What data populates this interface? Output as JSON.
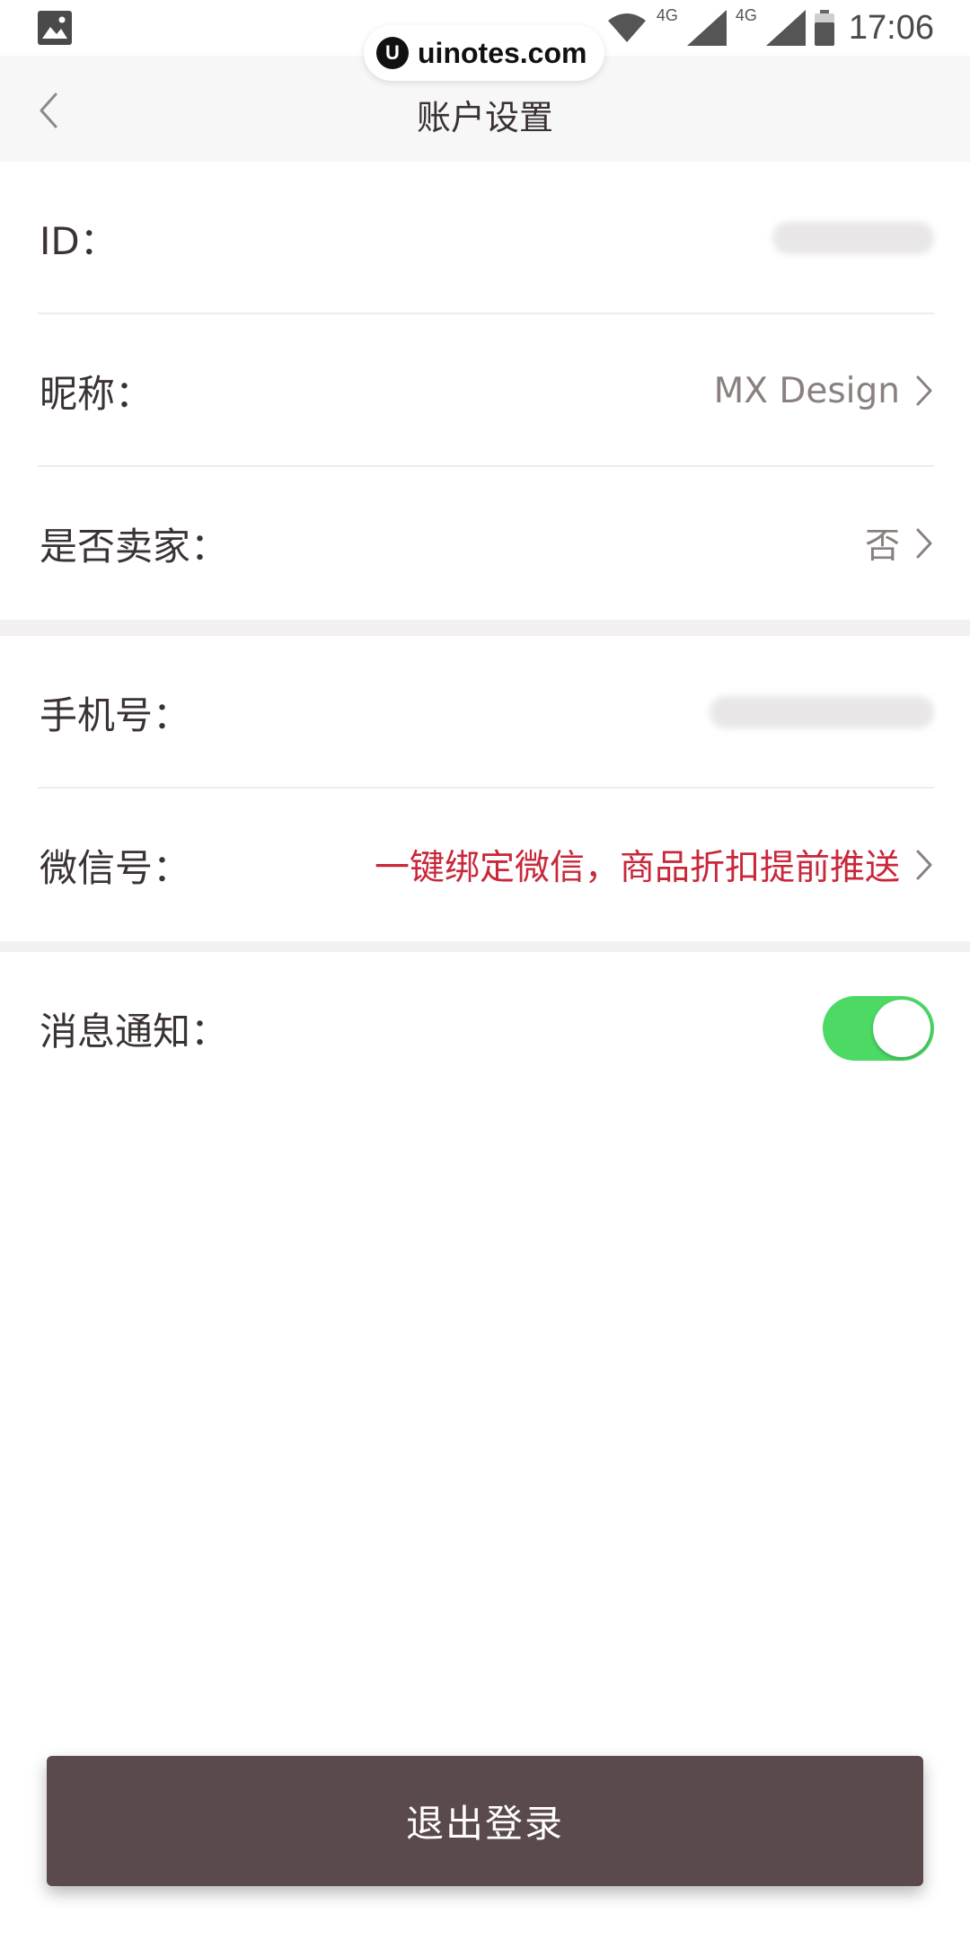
{
  "status_bar": {
    "left_icon": "image-icon",
    "network_1": "4G",
    "network_2": "4G",
    "time": "17:06"
  },
  "watermark": {
    "logo": "U",
    "text": "uinotes.com"
  },
  "nav": {
    "back_icon": "chevron-left-icon",
    "title": "账户设置"
  },
  "section_account": {
    "rows": [
      {
        "label": "ID：",
        "value": ""
      },
      {
        "label": "昵称：",
        "value": "MX Design"
      },
      {
        "label": "是否卖家：",
        "value": "否"
      }
    ]
  },
  "section_contact": {
    "rows": [
      {
        "label": "手机号：",
        "value": ""
      },
      {
        "label": "微信号：",
        "value": "一键绑定微信，商品折扣提前推送"
      }
    ]
  },
  "section_notify": {
    "label": "消息通知：",
    "enabled": true
  },
  "logout": {
    "label": "退出登录"
  },
  "colors": {
    "accent_promo": "#c8283a",
    "toggle_on": "#4cd964",
    "logout_bg": "#5b4a4b"
  }
}
